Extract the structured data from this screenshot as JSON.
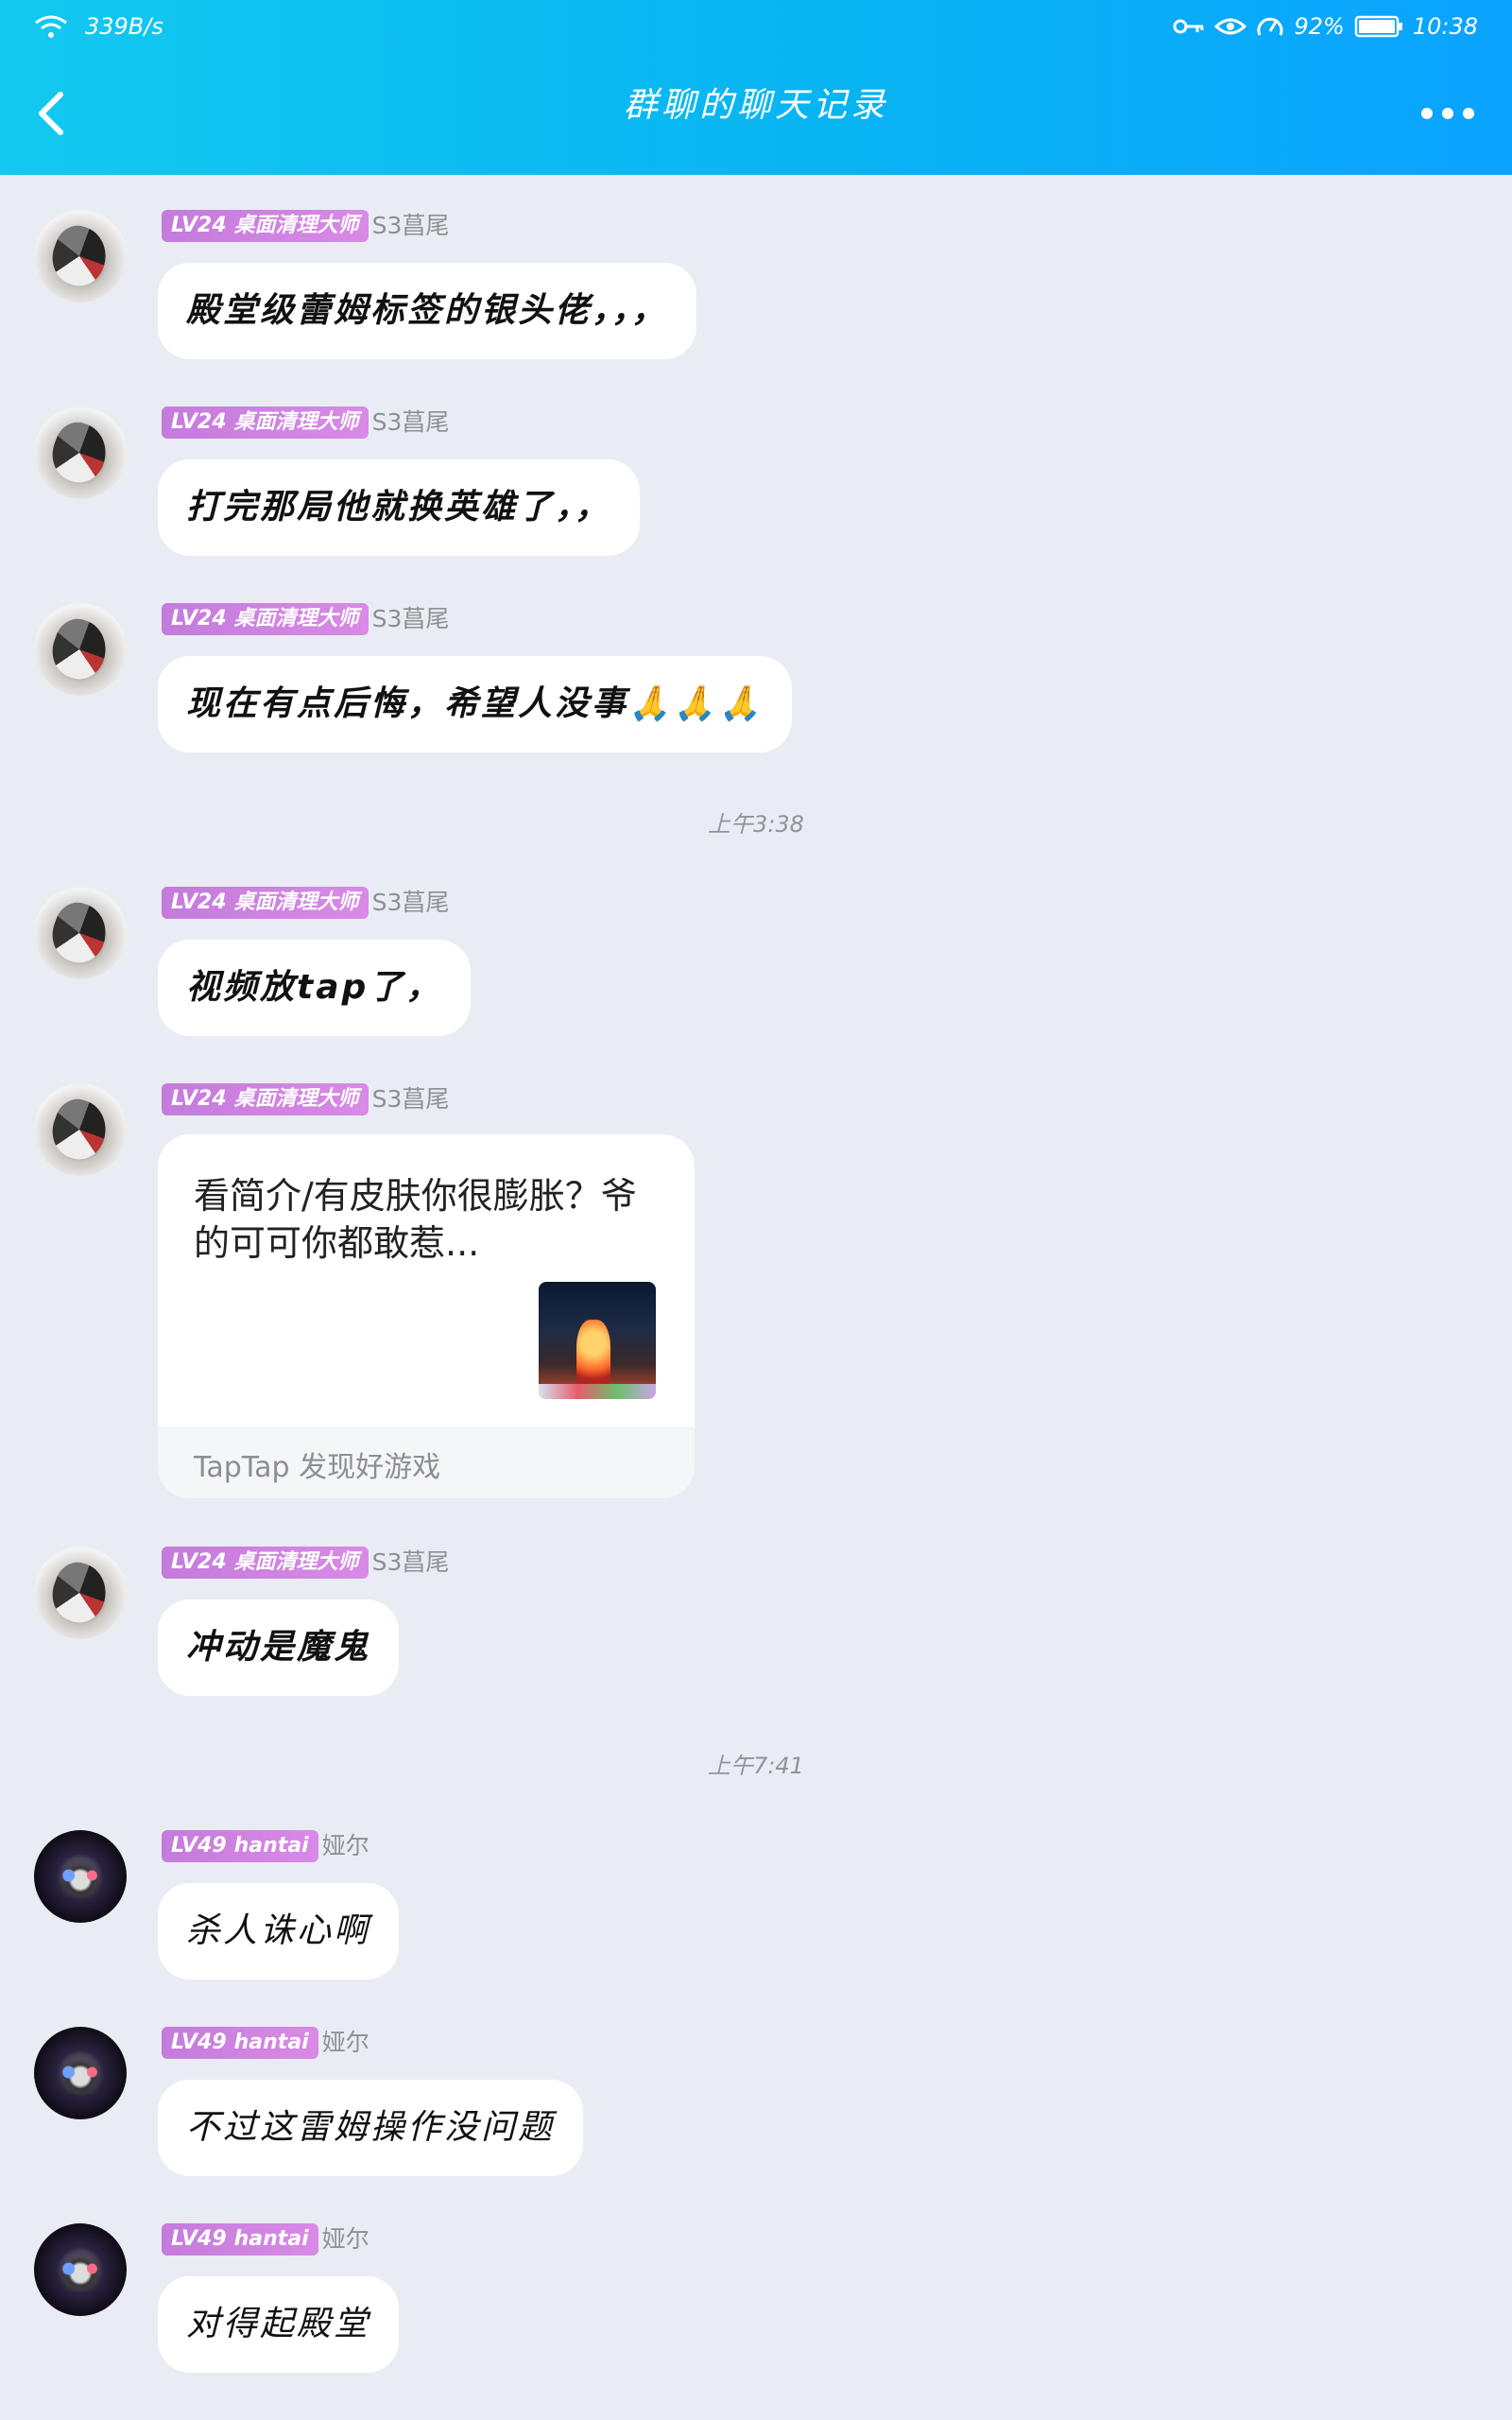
{
  "status_bar": {
    "net_speed": "339B/s",
    "battery": "92%",
    "time": "10:38"
  },
  "header": {
    "title": "群聊的聊天记录"
  },
  "times": [
    "上午3:38",
    "上午7:41"
  ],
  "card": {
    "text": "看简介/有皮肤你很膨胀？爷的可可你都敢惹...",
    "source": "TapTap 发现好游戏"
  },
  "messages": [
    {
      "level": "LV24",
      "title": "桌面清理大师",
      "nick": "S3菖尾",
      "text": "殿堂级蕾姆标签的银头佬，，，"
    },
    {
      "level": "LV24",
      "title": "桌面清理大师",
      "nick": "S3菖尾",
      "text": "打完那局他就换英雄了，，"
    },
    {
      "level": "LV24",
      "title": "桌面清理大师",
      "nick": "S3菖尾",
      "text": "现在有点后悔，希望人没事🙏🙏🙏"
    },
    {
      "level": "LV24",
      "title": "桌面清理大师",
      "nick": "S3菖尾",
      "text": "视频放tap了，"
    },
    {
      "level": "LV24",
      "title": "桌面清理大师",
      "nick": "S3菖尾",
      "text": ""
    },
    {
      "level": "LV24",
      "title": "桌面清理大师",
      "nick": "S3菖尾",
      "text": "冲动是魔鬼"
    },
    {
      "level": "LV49",
      "title": "hantai",
      "nick": "娅尔",
      "text": "杀人诛心啊"
    },
    {
      "level": "LV49",
      "title": "hantai",
      "nick": "娅尔",
      "text": "不过这雷姆操作没问题"
    },
    {
      "level": "LV49",
      "title": "hantai",
      "nick": "娅尔",
      "text": "对得起殿堂"
    }
  ]
}
